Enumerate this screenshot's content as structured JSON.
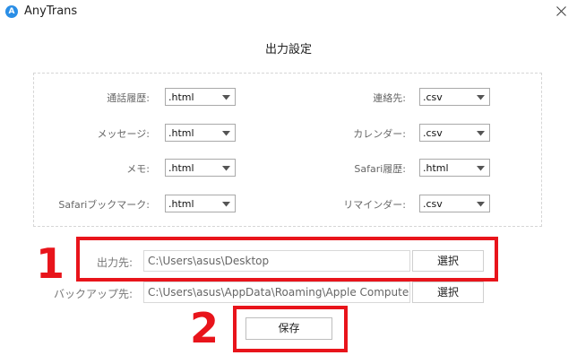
{
  "window": {
    "title": "AnyTrans",
    "icon": "anytrans-logo-icon",
    "close_icon": "close-icon"
  },
  "dialog": {
    "title": "出力設定"
  },
  "settings": {
    "left": [
      {
        "label": "通話履歴:",
        "value": ".html"
      },
      {
        "label": "メッセージ:",
        "value": ".html"
      },
      {
        "label": "メモ:",
        "value": ".html"
      },
      {
        "label": "Safariブックマーク:",
        "value": ".html"
      }
    ],
    "right": [
      {
        "label": "連絡先:",
        "value": ".csv"
      },
      {
        "label": "カレンダー:",
        "value": ".csv"
      },
      {
        "label": "Safari履歴:",
        "value": ".html"
      },
      {
        "label": "リマインダー:",
        "value": ".csv"
      }
    ]
  },
  "output": {
    "label": "出力先:",
    "path": "C:\\Users\\asus\\Desktop",
    "button": "選択"
  },
  "backup": {
    "label": "バックアップ先:",
    "path": "C:\\Users\\asus\\AppData\\Roaming\\Apple Computer",
    "button": "選択"
  },
  "save_button": "保存",
  "annotations": {
    "marker_1": "1",
    "marker_2": "2",
    "color": "#e8141b"
  }
}
